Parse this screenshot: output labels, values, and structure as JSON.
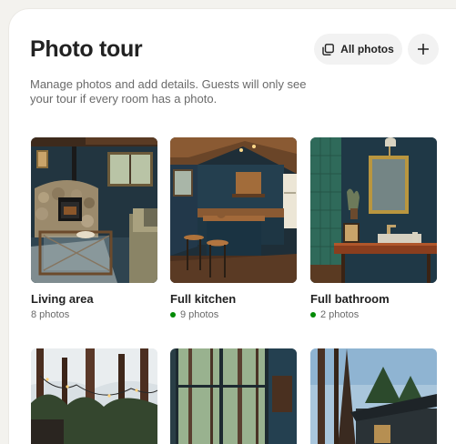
{
  "header": {
    "title": "Photo tour",
    "all_photos_label": "All photos"
  },
  "description": "Manage photos and add details. Guests will only see your tour if every room has a photo.",
  "rooms": [
    {
      "name": "Living area",
      "count": "8 photos",
      "complete": false
    },
    {
      "name": "Full kitchen",
      "count": "9 photos",
      "complete": true
    },
    {
      "name": "Full bathroom",
      "count": "2 photos",
      "complete": true
    }
  ],
  "colors": {
    "complete_dot": "#008a05"
  },
  "icons": {
    "all_photos": "stack-icon",
    "add": "plus-icon"
  }
}
